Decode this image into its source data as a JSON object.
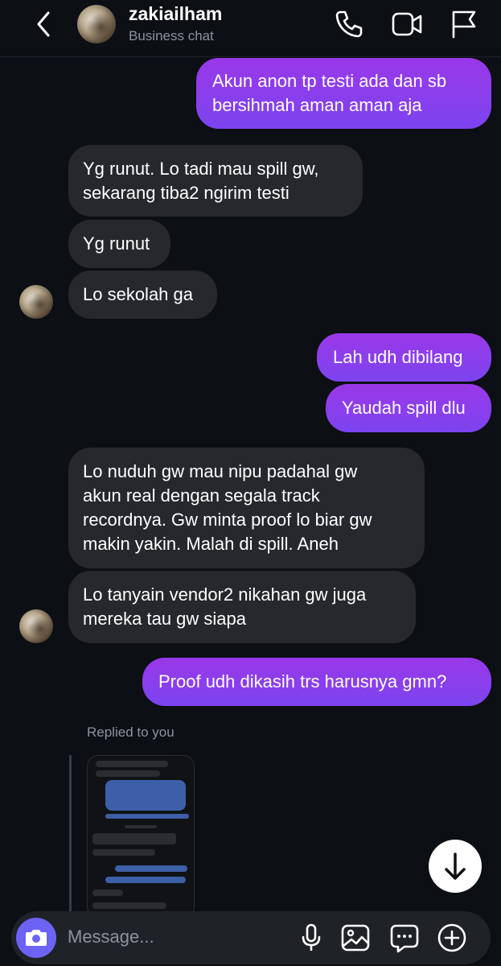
{
  "header": {
    "username": "zakiailham",
    "subtitle": "Business chat"
  },
  "messages": [
    {
      "dir": "out",
      "text": "Akun anon tp testi ada dan sb\nbersihmah aman aman aja"
    },
    {
      "dir": "in",
      "text": "Yg runut. Lo tadi mau spill gw,\nsekarang tiba2 ngirim testi"
    },
    {
      "dir": "in",
      "text": "Yg runut"
    },
    {
      "dir": "in",
      "text": "Lo sekolah ga"
    },
    {
      "dir": "out",
      "text": "Lah udh dibilang"
    },
    {
      "dir": "out",
      "text": "Yaudah spill dlu"
    },
    {
      "dir": "in",
      "text": "Lo nuduh gw mau nipu padahal gw\nakun real dengan segala track\nrecordnya. Gw minta proof lo biar gw\nmakin yakin. Malah di spill. Aneh"
    },
    {
      "dir": "in",
      "text": "Lo tanyain vendor2 nikahan gw juga\nmereka tau gw siapa"
    },
    {
      "dir": "out",
      "text": "Proof udh dikasih trs harusnya gmn?"
    }
  ],
  "reply": {
    "label": "Replied to you"
  },
  "composer": {
    "placeholder": "Message..."
  },
  "colors": {
    "background": "#0c0f14",
    "outgoing_bubble": "#8b3ee0",
    "incoming_bubble": "#26282d",
    "camera_button": "#6c63f5"
  },
  "icons": [
    "back-icon",
    "phone-icon",
    "video-icon",
    "flag-icon",
    "arrow-down-icon",
    "camera-icon",
    "mic-icon",
    "image-icon",
    "sticker-icon",
    "plus-icon"
  ]
}
